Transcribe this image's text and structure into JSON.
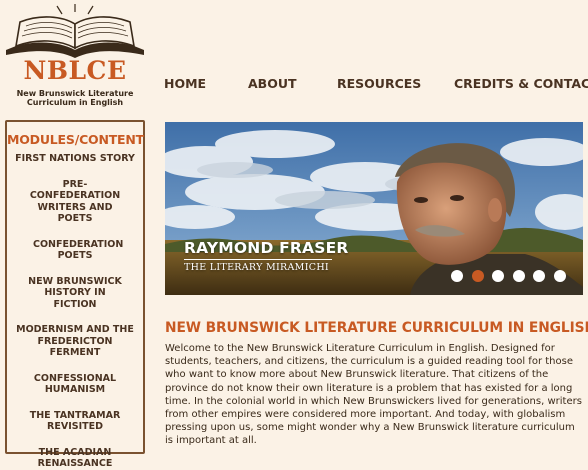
{
  "logo": {
    "acronym": "NBLCE",
    "subtitle_line1": "New Brunswick Literature",
    "subtitle_line2": "Curriculum in English"
  },
  "nav": {
    "items": [
      "HOME",
      "ABOUT",
      "RESOURCES",
      "CREDITS & CONTACTS"
    ]
  },
  "sidebar": {
    "title": "MODULES/CONTENT",
    "items": [
      "FIRST NATIONS STORY",
      "PRE-CONFEDERATION WRITERS AND POETS",
      "CONFEDERATION POETS",
      "NEW BRUNSWICK HISTORY IN FICTION",
      "MODERNISM AND THE FREDERICTON FERMENT",
      "CONFESSIONAL HUMANISM",
      "THE TANTRAMAR REVISITED",
      "THE ACADIAN RENAISSANCE"
    ]
  },
  "hero": {
    "name": "RAYMOND FRASER",
    "work": "THE LITERARY MIRAMICHI",
    "slide_count": 6,
    "active_slide": 2
  },
  "main": {
    "heading": "NEW BRUNSWICK LITERATURE CURRICULUM IN ENGLISH",
    "intro": "Welcome to the New Brunswick Literature Curriculum in English. Designed for students, teachers, and citizens, the curriculum is a guided reading tool for those who want to know more about New Brunswick literature. That citizens of the province do not know their own literature is a problem that has existed for a long time. In the colonial world in which New Brunswickers lived for generations, writers from other empires were considered more important. And today, with globalism pressing upon us, some might wonder why a New Brunswick literature curriculum is important at all."
  },
  "colors": {
    "accent": "#c85a23",
    "text": "#3a2a1a",
    "background": "#fbf2e6",
    "sidebar_border": "#7a5230"
  },
  "icons": [
    "open-book-logo-icon"
  ]
}
